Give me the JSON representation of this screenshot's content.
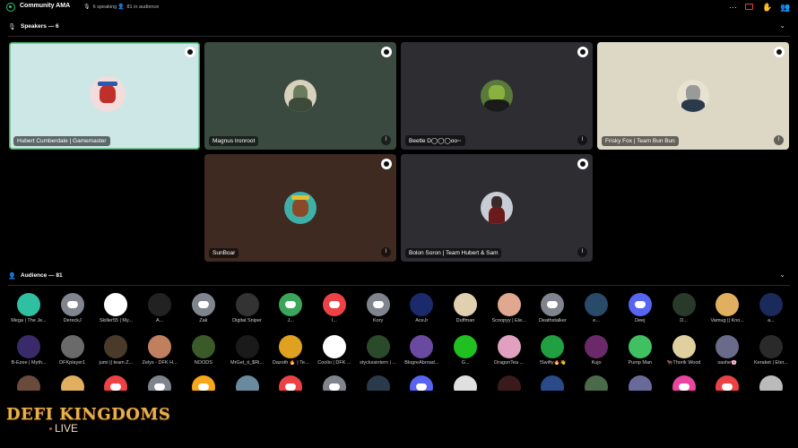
{
  "header": {
    "title": "Community AMA",
    "speaking": "6 speaking",
    "audience_count": "81 in audience"
  },
  "speakers_section": {
    "label": "Speakers — 6"
  },
  "audience_section": {
    "label": "Audience — 81"
  },
  "speakers": [
    {
      "name": "Hubert Cumberdale | Gamemaster",
      "bg": "#cde6e6",
      "muted": false,
      "active": true
    },
    {
      "name": "Magnus Ironroot",
      "bg": "#3a4a40",
      "muted": true,
      "active": false
    },
    {
      "name": "Beetle D◯◯◯oo◦◦",
      "bg": "#2e2e32",
      "muted": true,
      "active": false
    },
    {
      "name": "Frisky Fox | Team Bun Bun",
      "bg": "#ddd8c6",
      "muted": true,
      "active": false
    },
    {
      "name": "SunBoar",
      "bg": "#3e2a20",
      "muted": true,
      "active": false
    },
    {
      "name": "Bolon Soron | Team Hubert & Sam",
      "bg": "#2e2e32",
      "muted": true,
      "active": false
    }
  ],
  "audience_row1": [
    "Mega | The Je...",
    "DereckJ",
    "Skiller55 | My...",
    "A...",
    "Zak",
    "Digital Sniper",
    "J...",
    "I...",
    "Kory",
    "AceJr",
    "Duffman",
    "Scoopyy | Ete...",
    "Deathstalker",
    "e...",
    "Deej",
    "D...",
    "Vamug || Kno...",
    "a..."
  ],
  "audience_row2": [
    "B-Ezee | Myth...",
    "DFKplayer1",
    "jumi || team Z...",
    "Zelys - DFK H...",
    "NOODS",
    "MrGet_it_$Ri...",
    "Dazoth 🔥 | Te...",
    "Coolio | DFK ...",
    "styckssintern | ...",
    "BlogreAbroad...",
    "G...",
    "DragonTea ...",
    "!Swifty🔥👋",
    "Kujo",
    "Pump Man",
    "🐂Thorik Wood",
    "sashe🌸",
    "Keraket | Eter..."
  ],
  "brand": {
    "line1": "DEFI KINGDOMS",
    "line2": "LIVE"
  }
}
